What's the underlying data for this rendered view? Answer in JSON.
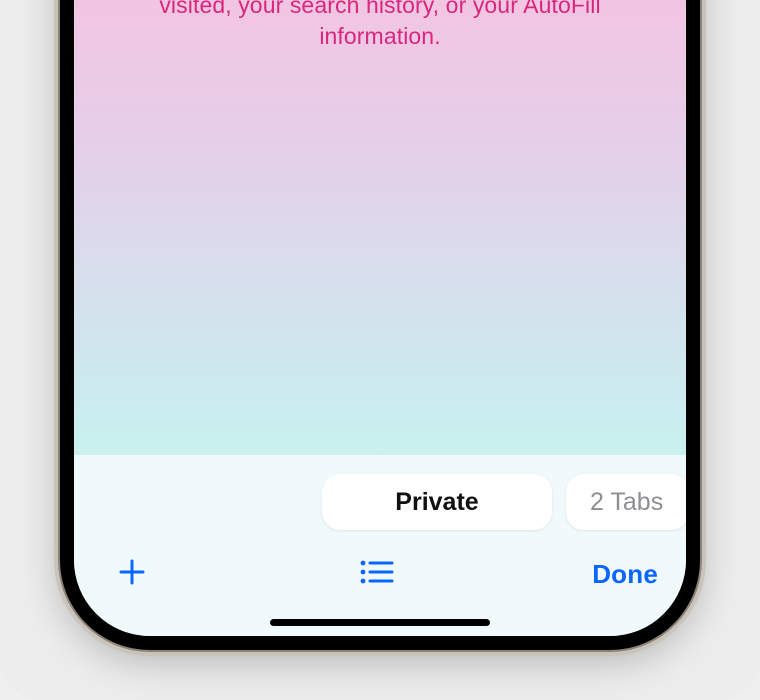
{
  "hint": {
    "line1": "visited, your search history, or your AutoFill",
    "line2": "information."
  },
  "tabGroups": {
    "active": "Private",
    "next": "2 Tabs"
  },
  "toolbar": {
    "done": "Done"
  },
  "colors": {
    "accent": "#0a66ff",
    "hintText": "#d9267e"
  }
}
